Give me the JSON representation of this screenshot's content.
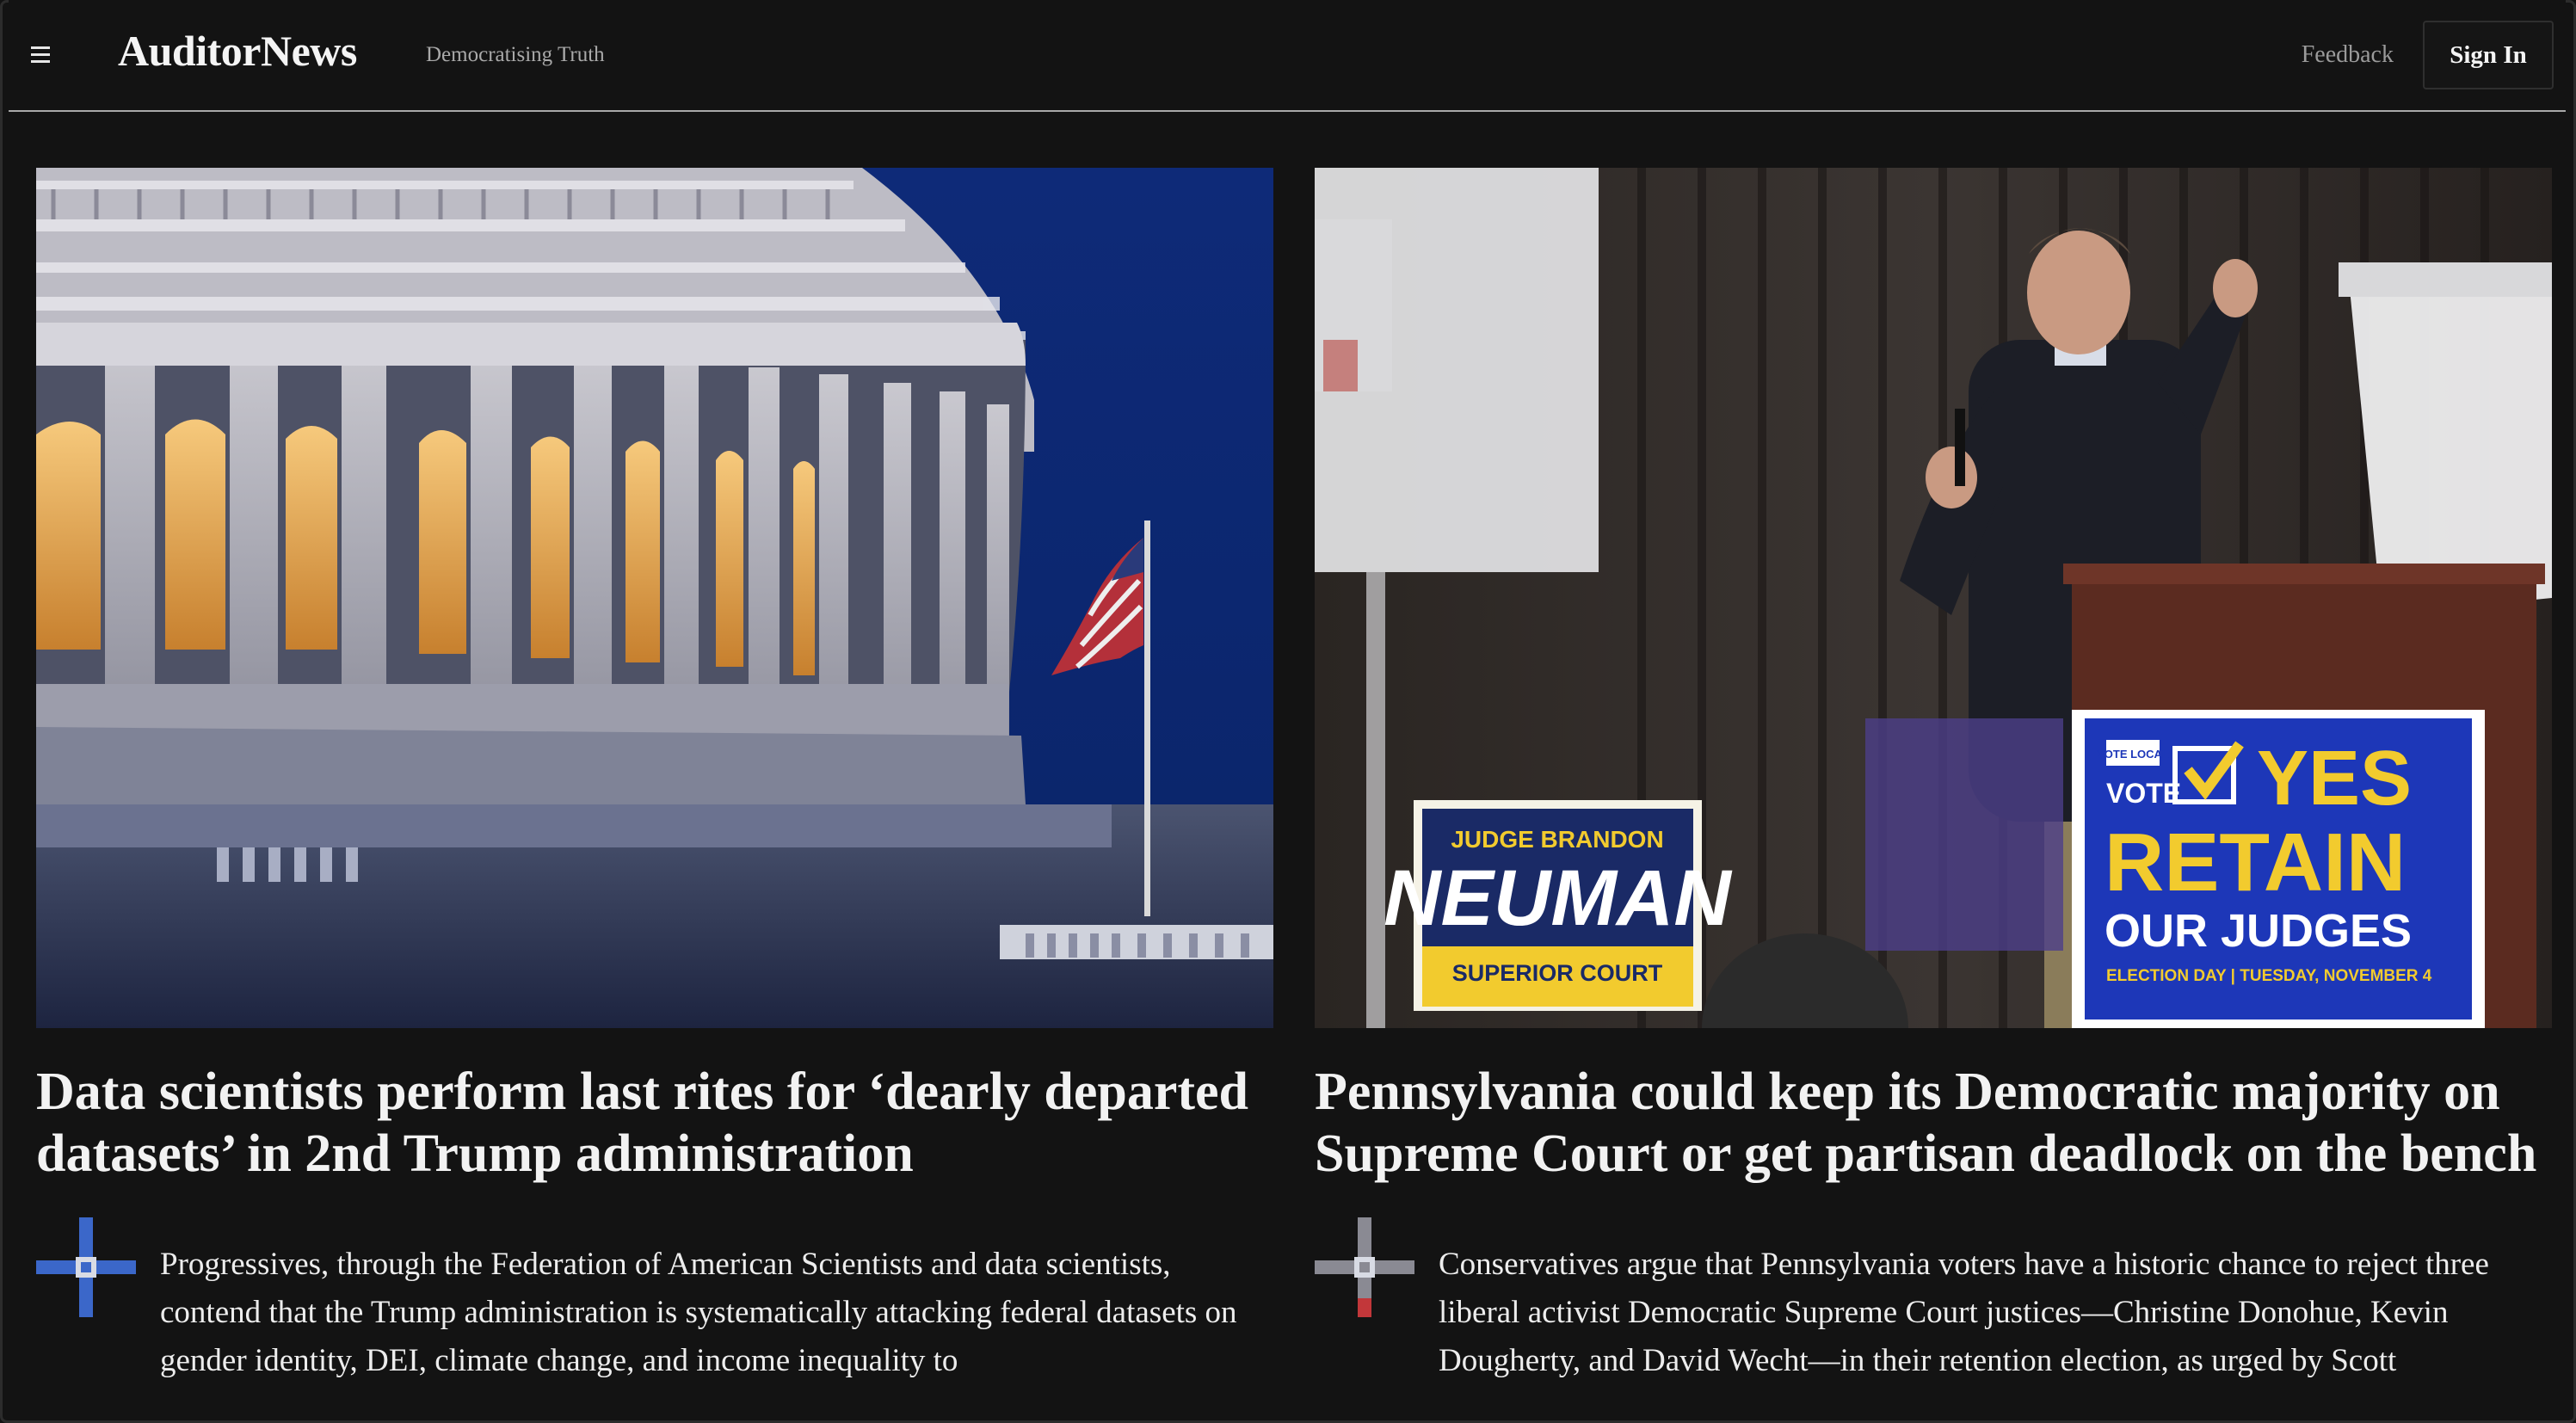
{
  "header": {
    "brand": "AuditorNews",
    "tagline": "Democratising Truth",
    "feedback_label": "Feedback",
    "signin_label": "Sign In",
    "menu_icon": "hamburger-menu-icon"
  },
  "colors": {
    "background": "#131313",
    "text": "#ececec",
    "divider": "#a8a8a8",
    "author_mark_left": "#3b67c9",
    "author_mark_right": "#8a8a93"
  },
  "articles": [
    {
      "image_alt": "U.S. Capitol dome at dusk with American flag",
      "headline": "Data scientists perform last rites for ‘dearly departed datasets’ in 2nd Trump administration",
      "summary": "Progressives, through the Federation of American Scientists and data scientists, contend that the Trump administration is systematically attacking federal datasets on gender identity, DEI, climate change, and income inequality to"
    },
    {
      "image_alt": "Speaker at podium with campaign signs",
      "headline": "Pennsylvania could keep its Democratic majority on Supreme Court or get partisan deadlock on the bench",
      "summary": "Conservatives argue that Pennsylvania voters have a historic chance to reject three liberal activist Democratic Supreme Court justices—Christine Donohue, Kevin Dougherty, and David Wecht—in their retention election, as urged by Scott",
      "image_text": {
        "sign_judge_top": "JUDGE BRANDON",
        "sign_judge_name": "NEUMAN",
        "sign_judge_court": "SUPERIOR COURT",
        "sign_vote_local": "VOTE LOCAL",
        "sign_vote": "VOTE",
        "sign_yes": "YES",
        "sign_retain": "RETAIN",
        "sign_judges": "OUR JUDGES",
        "sign_date": "ELECTION DAY | TUESDAY, NOVEMBER 4"
      }
    }
  ]
}
